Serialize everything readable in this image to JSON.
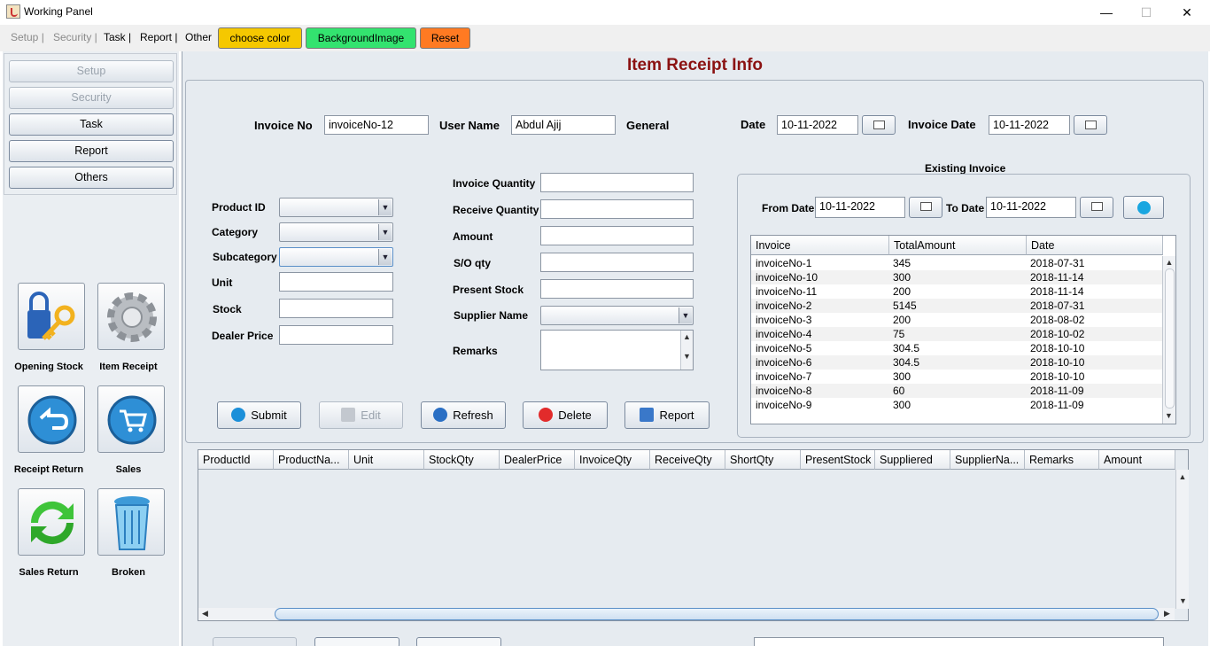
{
  "window": {
    "title": "Working Panel",
    "minimize": "—",
    "maximize": "☐",
    "close": "✕"
  },
  "menu": {
    "items": [
      "Setup |",
      "Security |",
      "Task |",
      "Report |",
      "Other"
    ],
    "choose_color": "choose color",
    "background_image": "BackgroundImage",
    "reset": "Reset",
    "colors": {
      "choose_color": "#f5c800",
      "background_image": "#33e36f",
      "reset": "#ff7a22"
    }
  },
  "sidebar": {
    "nav": [
      "Setup",
      "Security",
      "Task",
      "Report",
      "Others"
    ],
    "tiles": [
      "Opening Stock",
      "Item Receipt",
      "Receipt Return",
      "Sales",
      "Sales Return",
      "Broken"
    ]
  },
  "form": {
    "title": "Item Receipt Info",
    "invoice_no_label": "Invoice No",
    "invoice_no": "invoiceNo-12",
    "user_name_label": "User Name",
    "user_name": "Abdul Ajij",
    "general_label": "General",
    "date_label": "Date",
    "date": "10-11-2022",
    "invoice_date_label": "Invoice Date",
    "invoice_date": "10-11-2022",
    "product_id_label": "Product ID",
    "category_label": "Category",
    "subcategory_label": "Subcategory",
    "unit_label": "Unit",
    "stock_label": "Stock",
    "dealer_price_label": "Dealer Price",
    "invoice_quantity_label": "Invoice Quantity",
    "receive_quantity_label": "Receive Quantity",
    "amount_label": "Amount",
    "so_qty_label": "S/O qty",
    "present_stock_label": "Present Stock",
    "supplier_name_label": "Supplier Name",
    "remarks_label": "Remarks"
  },
  "actions": {
    "submit": "Submit",
    "edit": "Edit",
    "refresh": "Refresh",
    "delete": "Delete",
    "report": "Report"
  },
  "existing": {
    "title": "Existing Invoice",
    "from_label": "From Date",
    "from_date": "10-11-2022",
    "to_label": "To Date",
    "to_date": "10-11-2022",
    "columns": [
      "Invoice",
      "TotalAmount",
      "Date"
    ],
    "rows": [
      [
        "invoiceNo-1",
        "345",
        "2018-07-31"
      ],
      [
        "invoiceNo-10",
        "300",
        "2018-11-14"
      ],
      [
        "invoiceNo-11",
        "200",
        "2018-11-14"
      ],
      [
        "invoiceNo-2",
        "5145",
        "2018-07-31"
      ],
      [
        "invoiceNo-3",
        "200",
        "2018-08-02"
      ],
      [
        "invoiceNo-4",
        "75",
        "2018-10-02"
      ],
      [
        "invoiceNo-5",
        "304.5",
        "2018-10-10"
      ],
      [
        "invoiceNo-6",
        "304.5",
        "2018-10-10"
      ],
      [
        "invoiceNo-7",
        "300",
        "2018-10-10"
      ],
      [
        "invoiceNo-8",
        "60",
        "2018-11-09"
      ],
      [
        "invoiceNo-9",
        "300",
        "2018-11-09"
      ]
    ]
  },
  "grid": {
    "columns": [
      "ProductId",
      "ProductNa...",
      "Unit",
      "StockQty",
      "DealerPrice",
      "InvoiceQty",
      "ReceiveQty",
      "ShortQty",
      "PresentStock",
      "Suppliered",
      "SupplierNa...",
      "Remarks",
      "Amount"
    ]
  }
}
